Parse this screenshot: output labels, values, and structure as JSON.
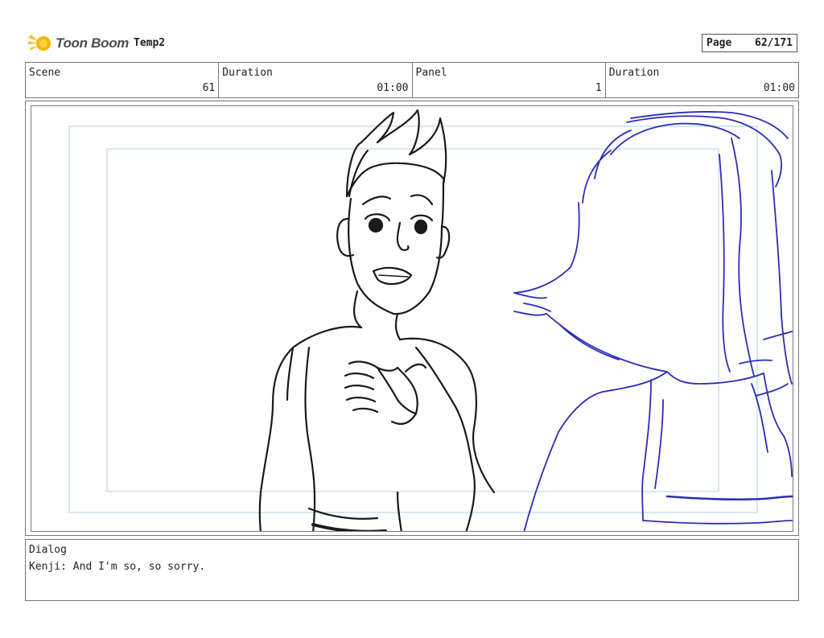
{
  "header": {
    "logo_text": "Toon Boom",
    "project_name": "Temp2",
    "page_label": "Page",
    "page_value": "62/171"
  },
  "info": {
    "scene_label": "Scene",
    "scene_value": "61",
    "scene_duration_label": "Duration",
    "scene_duration_value": "01:00",
    "panel_label": "Panel",
    "panel_value": "1",
    "panel_duration_label": "Duration",
    "panel_duration_value": "01:00"
  },
  "dialog": {
    "label": "Dialog",
    "text": "Kenji: And I'm so, so sorry."
  },
  "colors": {
    "safe_frame": "#b9dde6",
    "sketch_black": "#1a1a1a",
    "sketch_blue": "#2b2db5"
  }
}
